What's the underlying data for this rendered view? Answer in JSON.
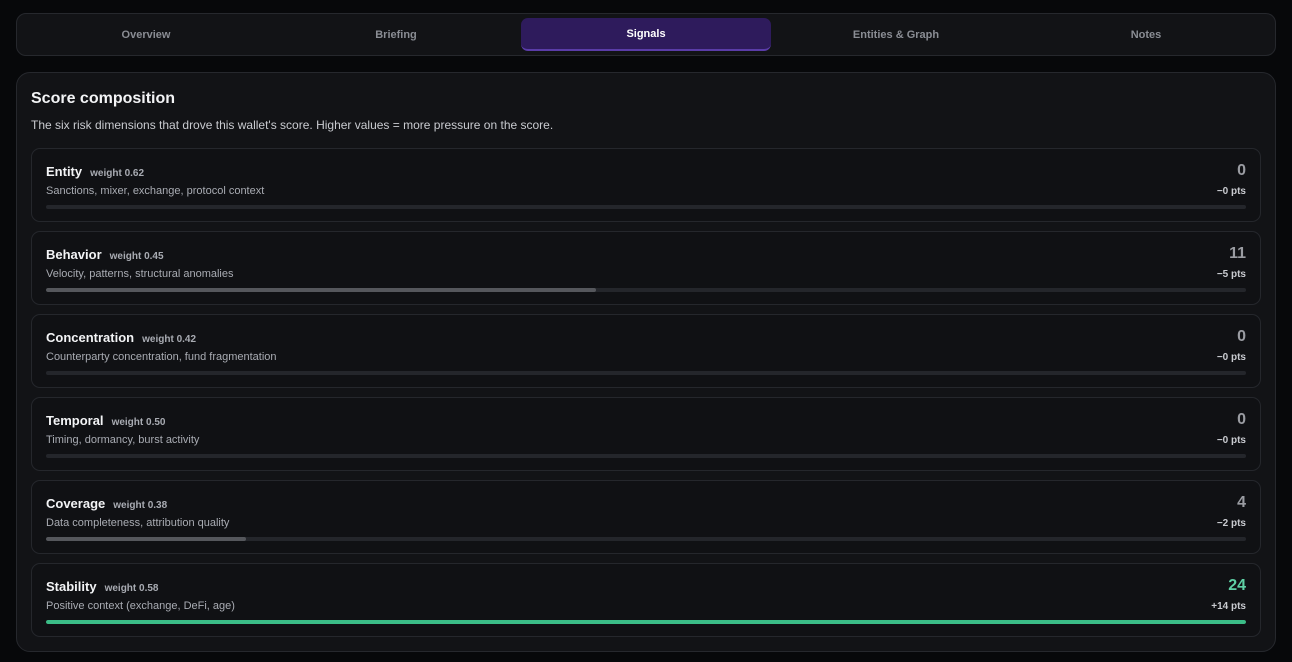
{
  "tabs": [
    {
      "label": "Overview",
      "active": false
    },
    {
      "label": "Briefing",
      "active": false
    },
    {
      "label": "Signals",
      "active": true
    },
    {
      "label": "Entities & Graph",
      "active": false
    },
    {
      "label": "Notes",
      "active": false
    }
  ],
  "panel": {
    "title": "Score composition",
    "description": "The six risk dimensions that drove this wallet's score. Higher values = more pressure on the score."
  },
  "dimensions": [
    {
      "name": "Entity",
      "weight": "weight 0.62",
      "description": "Sanctions, mixer, exchange, protocol context",
      "score": "0",
      "points": "−0 pts",
      "level": 0,
      "positive": false
    },
    {
      "name": "Behavior",
      "weight": "weight 0.45",
      "description": "Velocity, patterns, structural anomalies",
      "score": "11",
      "points": "−5 pts",
      "level": 0.458,
      "positive": false
    },
    {
      "name": "Concentration",
      "weight": "weight 0.42",
      "description": "Counterparty concentration, fund fragmentation",
      "score": "0",
      "points": "−0 pts",
      "level": 0,
      "positive": false
    },
    {
      "name": "Temporal",
      "weight": "weight 0.50",
      "description": "Timing, dormancy, burst activity",
      "score": "0",
      "points": "−0 pts",
      "level": 0,
      "positive": false
    },
    {
      "name": "Coverage",
      "weight": "weight 0.38",
      "description": "Data completeness, attribution quality",
      "score": "4",
      "points": "−2 pts",
      "level": 0.167,
      "positive": false
    },
    {
      "name": "Stability",
      "weight": "weight 0.58",
      "description": "Positive context (exchange, DeFi, age)",
      "score": "24",
      "points": "+14 pts",
      "level": 1,
      "positive": true
    }
  ],
  "colors": {
    "active_tab": "#2e1b5c",
    "positive": "#3bbd87",
    "neutral_fill": "#55575c"
  }
}
